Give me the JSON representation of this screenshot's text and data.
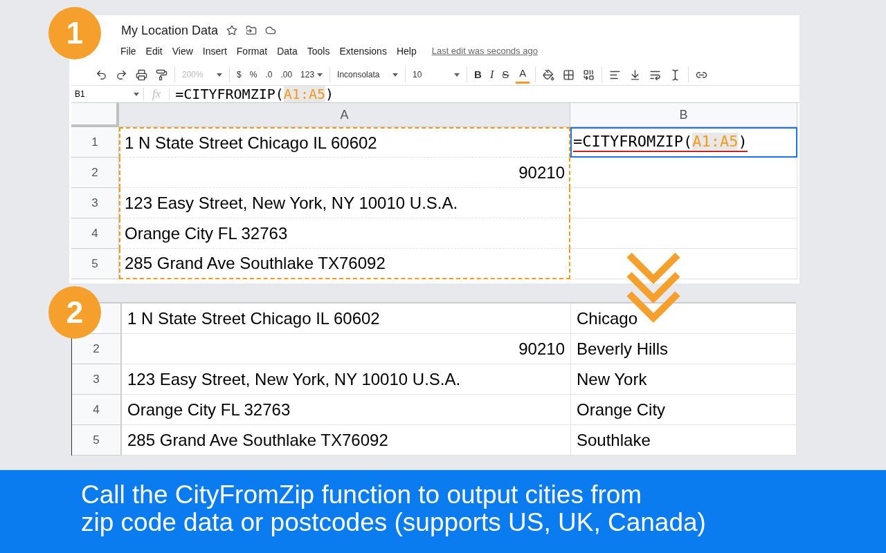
{
  "badges": [
    "1",
    "2"
  ],
  "document": {
    "title": "My Location Data",
    "menu": [
      "File",
      "Edit",
      "View",
      "Insert",
      "Format",
      "Data",
      "Tools",
      "Extensions",
      "Help"
    ],
    "last_edit": "Last edit was seconds ago"
  },
  "toolbar": [
    {
      "label": "200%",
      "disabled": true
    },
    {
      "label": "$",
      "disabled": false
    },
    {
      "label": "%",
      "disabled": false
    },
    {
      "label": ".0",
      "disabled": false
    },
    {
      "label": ".00",
      "disabled": false
    },
    {
      "label": "123",
      "disabled": false
    },
    {
      "label": "Inconsolata",
      "disabled": false
    },
    {
      "label": "10",
      "disabled": false
    },
    {
      "label": "B",
      "disabled": false
    },
    {
      "label": "I",
      "disabled": false
    },
    {
      "label": "S",
      "disabled": false
    },
    {
      "label": "A",
      "disabled": false
    }
  ],
  "formula_bar": {
    "cell": "B1",
    "fx": "fx",
    "formula": {
      "prefix": "=CITYFROMZIP(",
      "range": "A1:A5",
      "suffix": ")"
    }
  },
  "sheet_1": {
    "columns": [
      "A",
      "B"
    ],
    "rows": [
      {
        "number": "1",
        "a": "1 N State Street Chicago IL 60602",
        "numeric": false,
        "b": {
          "prefix": "=CITYFROMZIP(",
          "range": "A1:A5",
          "suffix": ")"
        }
      },
      {
        "number": "2",
        "a": "90210",
        "numeric": true
      },
      {
        "number": "3",
        "a": "123 Easy Street, New York, NY 10010 U.S.A.",
        "numeric": false
      },
      {
        "number": "4",
        "a": "Orange City FL 32763",
        "numeric": false
      },
      {
        "number": "5",
        "a": "285 Grand Ave Southlake TX76092",
        "numeric": false
      }
    ]
  },
  "sheet_2": {
    "rows": [
      {
        "a": "1 N State Street Chicago IL 60602",
        "numeric": false,
        "b": "Chicago"
      },
      {
        "number": "2",
        "a": "90210",
        "numeric": true,
        "b": "Beverly Hills"
      },
      {
        "number": "3",
        "a": "123 Easy Street, New York, NY 10010 U.S.A.",
        "numeric": false,
        "b": "New York"
      },
      {
        "number": "4",
        "a": "Orange City FL 32763",
        "numeric": false,
        "b": "Orange City"
      },
      {
        "number": "5",
        "a": "285 Grand Ave Southlake TX76092",
        "numeric": false,
        "b": "Southlake"
      }
    ]
  },
  "caption": [
    "Call the CityFromZip function to output cities from",
    "zip code data or postcodes (supports US, UK, Canada)"
  ]
}
